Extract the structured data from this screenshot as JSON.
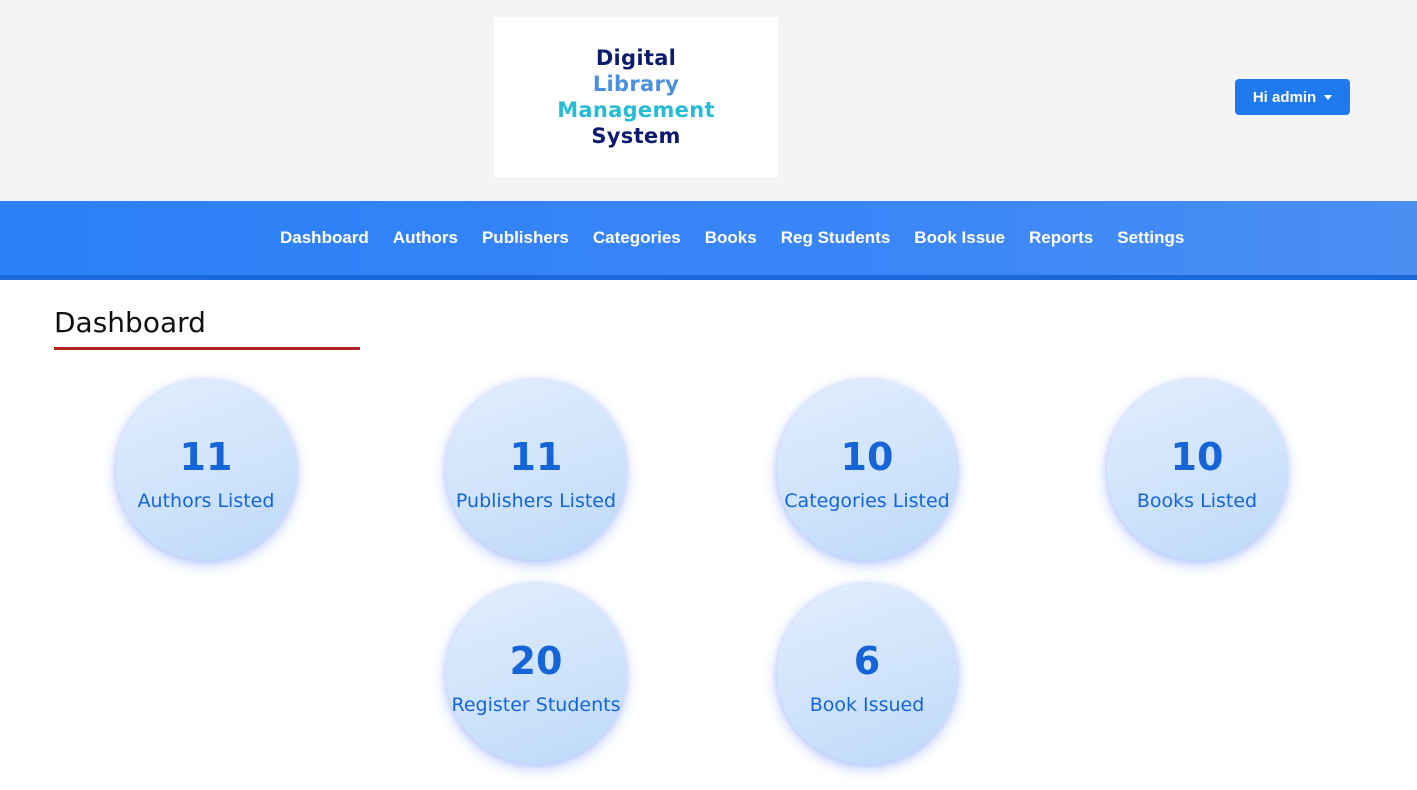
{
  "header": {
    "logo_lines": [
      "Digital",
      "Library",
      "Management",
      "System"
    ],
    "user_button": "Hi admin"
  },
  "nav": {
    "items": [
      "Dashboard",
      "Authors",
      "Publishers",
      "Categories",
      "Books",
      "Reg Students",
      "Book Issue",
      "Reports",
      "Settings"
    ]
  },
  "page": {
    "title": "Dashboard"
  },
  "stats": [
    {
      "value": "11",
      "label": "Authors Listed"
    },
    {
      "value": "11",
      "label": "Publishers Listed"
    },
    {
      "value": "10",
      "label": "Categories Listed"
    },
    {
      "value": "10",
      "label": "Books Listed"
    },
    {
      "value": "20",
      "label": "Register Students"
    },
    {
      "value": "6",
      "label": "Book Issued"
    }
  ],
  "colors": {
    "navbar": "#2b80f7",
    "accent": "#1565d8",
    "title_underline": "#b02424",
    "logo_dark": "#0d1b6e",
    "logo_blue": "#4a8fe0",
    "logo_teal": "#26bcd6"
  }
}
